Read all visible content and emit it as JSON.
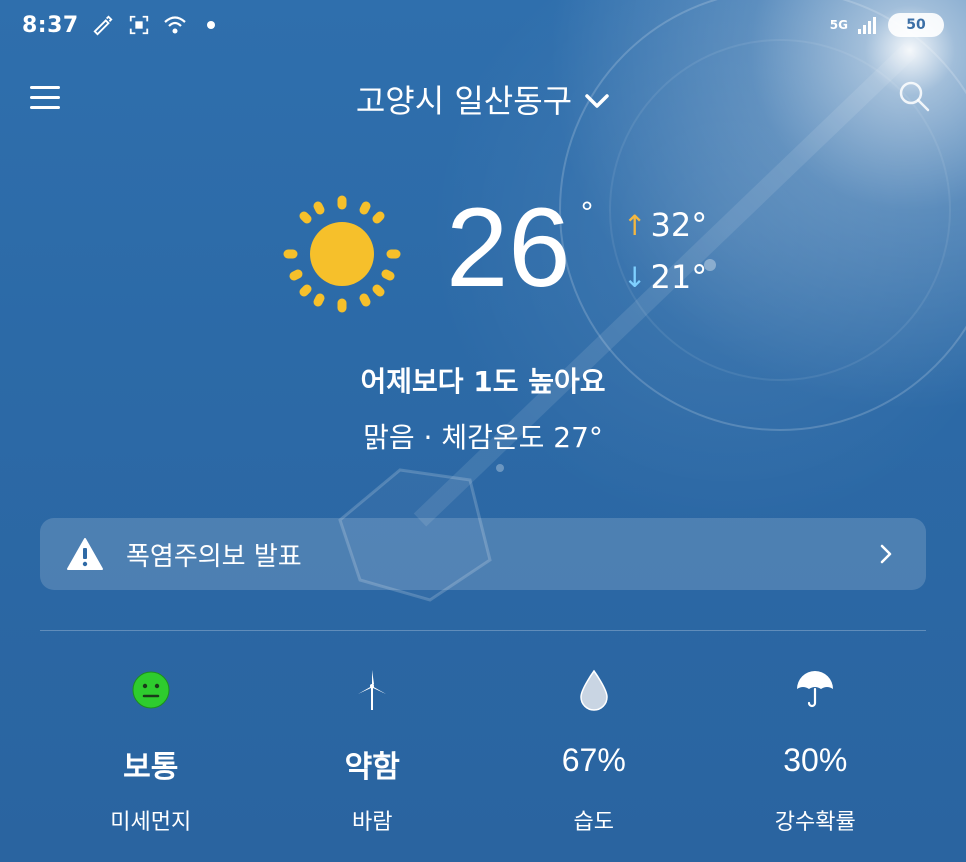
{
  "status_bar": {
    "time": "8:37",
    "network": "5G",
    "battery": "50"
  },
  "header": {
    "location": "고양시 일산동구"
  },
  "current": {
    "icon": "sun-icon",
    "temperature": "26",
    "degree_symbol": "°",
    "high": "32°",
    "low": "21°",
    "compare_text": "어제보다 1도 높아요",
    "condition_text": "맑음 · 체감온도 27°"
  },
  "alert": {
    "text": "폭염주의보 발표"
  },
  "stats": [
    {
      "icon": "neutral-face-icon",
      "value": "보통",
      "label": "미세먼지"
    },
    {
      "icon": "wind-turbine-icon",
      "value": "약함",
      "label": "바람"
    },
    {
      "icon": "water-drop-icon",
      "value": "67%",
      "label": "습도"
    },
    {
      "icon": "umbrella-icon",
      "value": "30%",
      "label": "강수확률"
    }
  ],
  "colors": {
    "background": "#2c6aa7",
    "sun": "#f6c02b",
    "high_arrow": "#f4b740",
    "low_arrow": "#7fd0ff",
    "dust_status": "#2ecc2e"
  }
}
